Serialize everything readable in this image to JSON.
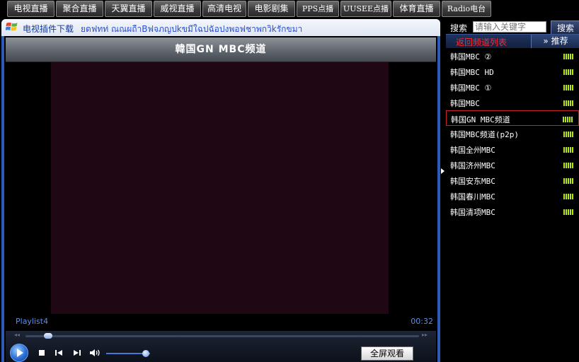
{
  "tabs": [
    "电视直播",
    "聚合直播",
    "天翼直播",
    "威视直播",
    "高清电视",
    "电影剧集",
    "PPS点播",
    "UUSEE点播",
    "体育直播",
    "Radio电台"
  ],
  "player": {
    "plugin_link": "电视插件下载",
    "ticker": "ยดฟทท่ ณณผถืาBฟจภญปkขมีใฉปฉัอปงพอฟชาพกวิkรักขมา",
    "channel_title": "韓国GN MBC频道",
    "media_label": "Playlist4",
    "time": "00:32",
    "seek_position": 0.04,
    "volume": 0.9,
    "fullscreen_label": "全屏观看"
  },
  "sidebar": {
    "search_label": "搜索",
    "search_placeholder": "请输入关键字",
    "search_button": "搜索",
    "back_link": "返回频道列表",
    "recommend_label": "推荐",
    "selected_index": 4,
    "channels": [
      {
        "name": "韩国MBC ②",
        "signal": 5
      },
      {
        "name": "韩国MBC HD",
        "signal": 5
      },
      {
        "name": "韩国MBC ①",
        "signal": 5
      },
      {
        "name": "韩国MBC",
        "signal": 5
      },
      {
        "name": "韩国GN MBC频道",
        "signal": 5
      },
      {
        "name": "韩国MBC频道(p2p)",
        "signal": 5
      },
      {
        "name": "韩国全州MBC",
        "signal": 5
      },
      {
        "name": "韩国济州MBC",
        "signal": 5
      },
      {
        "name": "韩国安东MBC",
        "signal": 5
      },
      {
        "name": "韩国春川MBC",
        "signal": 5
      },
      {
        "name": "韩国清项MBC",
        "signal": 5
      }
    ]
  },
  "colors": {
    "selected_border": "#c8222a",
    "back_link": "#ff2a2a",
    "signal": "#b5e61d"
  }
}
